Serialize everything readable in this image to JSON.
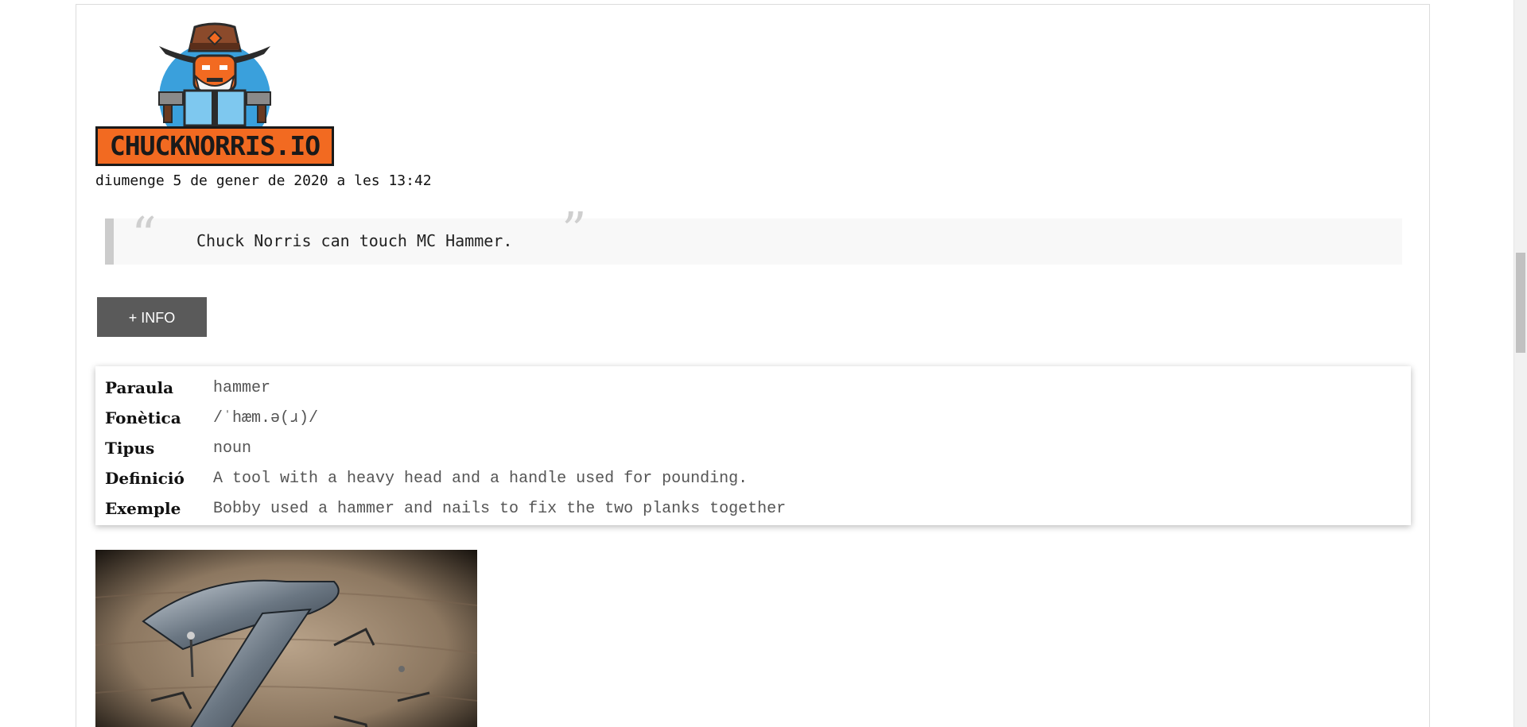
{
  "logo": {
    "text": "CHUCKNORRIS.IO"
  },
  "joke": {
    "date": "diumenge 5 de gener de 2020 a les 13:42",
    "open_quote_glyph": "“",
    "close_quote_glyph": "”",
    "text": "Chuck Norris can touch MC Hammer."
  },
  "info_button": {
    "label": "+ INFO"
  },
  "definition": {
    "rows": [
      {
        "key": "Paraula",
        "value": "hammer"
      },
      {
        "key": "Fonètica",
        "value": "/ˈhæm.ə(ɹ)/"
      },
      {
        "key": "Tipus",
        "value": "noun"
      },
      {
        "key": "Definició",
        "value": "A tool with a heavy head and a handle used for pounding."
      },
      {
        "key": "Exemple",
        "value": "Bobby used a hammer and nails to fix the two planks together"
      }
    ]
  },
  "colors": {
    "logo_orange": "#f26a21",
    "logo_blue": "#3aa0dc",
    "button_bg": "#5a5a5a",
    "quote_bg": "#f8f8f8",
    "quote_border": "#cccccc"
  },
  "scrollbar": {
    "position_fraction": 0.35
  }
}
